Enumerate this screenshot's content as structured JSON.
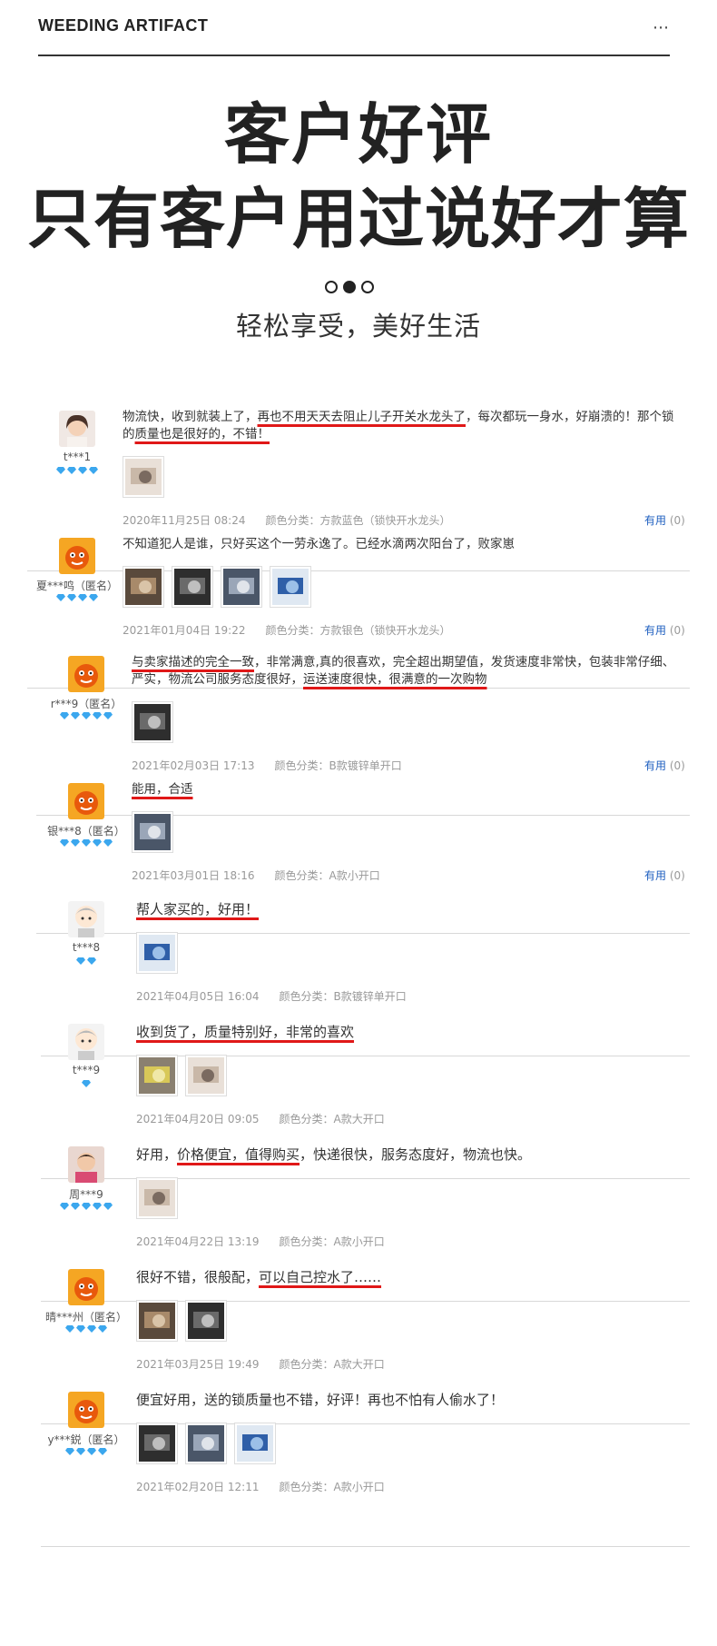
{
  "header": {
    "brand": "WEEDING ARTIFACT",
    "menu": "⋯"
  },
  "hero": {
    "title_line1": "客户好评",
    "title_line2": "只有客户用过说好才算",
    "subtitle": "轻松享受，美好生活"
  },
  "colors": {
    "underline": "#e01818",
    "helpful_link": "#2060c0",
    "gem": "#3ba7ee",
    "meta_text": "#999999"
  },
  "reviews": [
    {
      "user": "t***1",
      "gems": 4,
      "avatar": "girl-photo",
      "text_parts": [
        {
          "t": "物流快，收到就装上了，",
          "u": false
        },
        {
          "t": "再也不用天天去阻止儿子开关水龙头了",
          "u": true
        },
        {
          "t": "，每次都玩一身水，好崩溃的！那个锁的",
          "u": false
        },
        {
          "t": "质量也是很好的，不错！",
          "u": true
        }
      ],
      "images": 1,
      "date": "2020年11月25日 08:24",
      "variant": "颜色分类：方款蓝色（锁快开水龙头）",
      "helpful_label": "有用",
      "helpful_count": "(0)"
    },
    {
      "user": "夏***鸣（匿名）",
      "gems": 4,
      "avatar": "tmall-mascot",
      "text_parts": [
        {
          "t": "不知道犯人是谁，只好买这个一劳永逸了。已经水滴两次阳台了，败家崽",
          "u": false
        }
      ],
      "images": 4,
      "date": "2021年01月04日 19:22",
      "variant": "颜色分类：方款银色（锁快开水龙头）",
      "helpful_label": "有用",
      "helpful_count": "(0)"
    },
    {
      "user": "r***9（匿名）",
      "gems": 5,
      "avatar": "tmall-mascot",
      "text_parts": [
        {
          "t": "与卖家描述的完全一致",
          "u": true
        },
        {
          "t": "，非常满意,真的很喜欢，完全超出期望值，发货速度非常快，包装非常仔细、严实，物流公司服务态度很好，",
          "u": false
        },
        {
          "t": "运送速度很快，很满意的一次购物",
          "u": true
        }
      ],
      "images": 1,
      "date": "2021年02月03日 17:13",
      "variant": "颜色分类：B款镀锌单开口",
      "helpful_label": "有用",
      "helpful_count": "(0)"
    },
    {
      "user": "银***8（匿名）",
      "gems": 5,
      "avatar": "tmall-mascot",
      "text_parts": [
        {
          "t": "能用，合适",
          "u": true
        }
      ],
      "images": 1,
      "date": "2021年03月01日 18:16",
      "variant": "颜色分类：A款小开口",
      "helpful_label": "有用",
      "helpful_count": "(0)"
    },
    {
      "user": "t***8",
      "gems": 2,
      "avatar": "cartoon-boy",
      "text_parts": [
        {
          "t": "帮人家买的，好用！",
          "u": true
        }
      ],
      "images": 1,
      "date": "2021年04月05日 16:04",
      "variant": "颜色分类：B款镀锌单开口"
    },
    {
      "user": "t***9",
      "gems": 1,
      "avatar": "cartoon-boy",
      "text_parts": [
        {
          "t": "收到货了，质量特别好，非常的喜欢",
          "u": true
        }
      ],
      "images": 2,
      "date": "2021年04月20日 09:05",
      "variant": "颜色分类：A款大开口"
    },
    {
      "user": "周***9",
      "gems": 5,
      "avatar": "child-photo",
      "text_parts": [
        {
          "t": "好用，",
          "u": false
        },
        {
          "t": "价格便宜，值得购买",
          "u": true
        },
        {
          "t": "，快递很快，服务态度好，物流也快。",
          "u": false
        }
      ],
      "images": 1,
      "date": "2021年04月22日 13:19",
      "variant": "颜色分类：A款小开口"
    },
    {
      "user": "晴***州（匿名）",
      "gems": 4,
      "avatar": "tmall-mascot",
      "text_parts": [
        {
          "t": "很好不错，很般配，",
          "u": false
        },
        {
          "t": "可以自己控水了……",
          "u": true
        }
      ],
      "images": 2,
      "date": "2021年03月25日 19:49",
      "variant": "颜色分类：A款大开口"
    },
    {
      "user": "y***鋭（匿名）",
      "gems": 4,
      "avatar": "tmall-mascot",
      "text_parts": [
        {
          "t": "便宜好用，送的锁质量也不错，好评！再也不怕有人偷水了！",
          "u": false
        }
      ],
      "images": 3,
      "date": "2021年02月20日 12:11",
      "variant": "颜色分类：A款小开口"
    }
  ]
}
